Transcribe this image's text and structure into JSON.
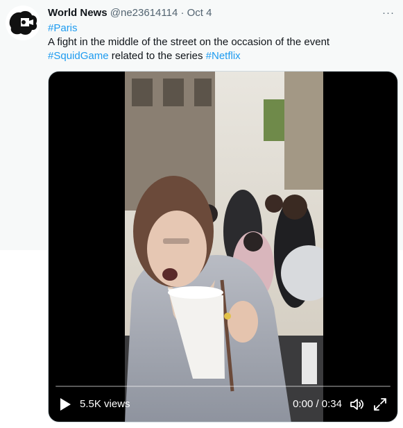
{
  "tweet": {
    "author": {
      "display_name": "World News",
      "handle": "@ne23614114",
      "separator": "·",
      "date": "Oct 4"
    },
    "more_label": "···",
    "text": {
      "line1_hashtag": "#Paris",
      "line2": "A fight in the middle of the street on the occasion of the event",
      "line3_hashtag1": "#SquidGame",
      "line3_middle": " related to the series ",
      "line3_hashtag2": "#Netflix"
    },
    "media": {
      "type": "video",
      "views": "5.5K views",
      "time": "0:00 / 0:34",
      "progress": 0.0
    }
  },
  "colors": {
    "link": "#1d9bf0",
    "secondary_text": "#536471",
    "tweet_background": "#f7f9f9"
  },
  "icons": {
    "avatar": "logo-avatar-icon",
    "more": "more-options-icon",
    "play": "play-icon",
    "volume": "volume-icon",
    "fullscreen": "fullscreen-icon"
  }
}
